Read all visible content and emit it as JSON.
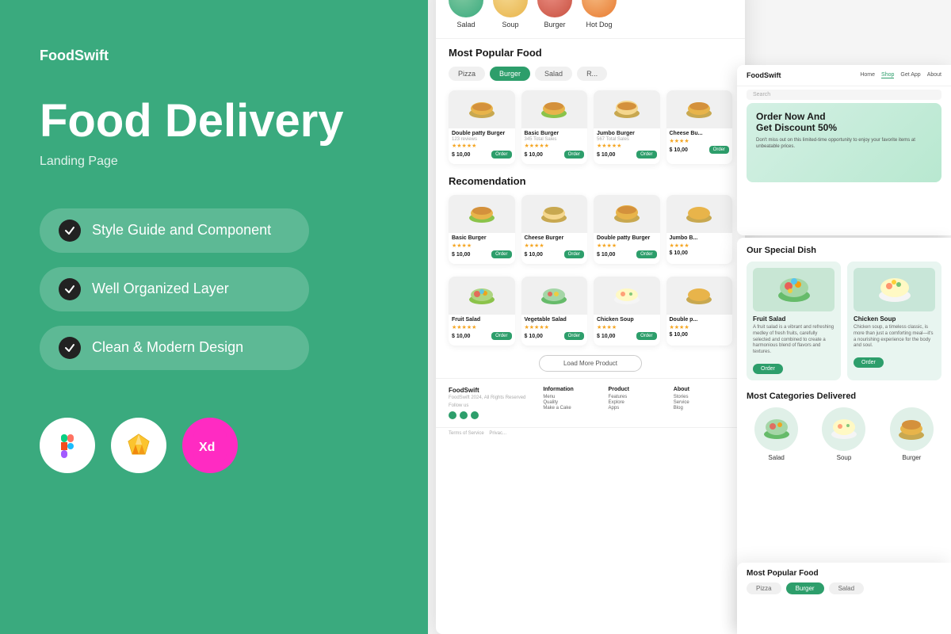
{
  "left": {
    "brand": "FoodSwift",
    "title": "Food Delivery",
    "subtitle": "Landing Page",
    "features": [
      {
        "id": "style-guide",
        "label": "Style Guide and Component"
      },
      {
        "id": "well-organized",
        "label": "Well Organized Layer"
      },
      {
        "id": "clean-modern",
        "label": "Clean & Modern Design"
      }
    ],
    "tools": [
      {
        "id": "figma",
        "label": "Figma"
      },
      {
        "id": "sketch",
        "label": "Sketch"
      },
      {
        "id": "xd",
        "label": "Adobe XD"
      }
    ]
  },
  "mockup": {
    "brand": "FoodSwift",
    "categories": [
      {
        "label": "Salad"
      },
      {
        "label": "Soup"
      },
      {
        "label": "Burger"
      }
    ],
    "most_popular_title": "Most Popular Food",
    "filter_tabs": [
      "Pizza",
      "Burger",
      "Salad",
      "R..."
    ],
    "active_tab": "Burger",
    "food_items_row1": [
      {
        "name": "Double patty Burger",
        "sub": "123 reviews",
        "price": "$ 10,00",
        "stars": "★★★★★"
      },
      {
        "name": "Basic Burger",
        "sub": "345 Total Sales",
        "price": "$ 10,00",
        "stars": "★★★★★"
      },
      {
        "name": "Jumbo Burger",
        "sub": "567 Total Sales",
        "price": "$ 10,00",
        "stars": "★★★★★"
      },
      {
        "name": "Cheese Bu...",
        "sub": "",
        "price": "$ 10,00",
        "stars": "★★★★"
      }
    ],
    "recommendation_title": "Recomendation",
    "food_items_row2": [
      {
        "name": "Basic Burger",
        "price": "$ 10,00",
        "stars": "★★★★"
      },
      {
        "name": "Cheese Burger",
        "price": "$ 10,00",
        "stars": "★★★★"
      },
      {
        "name": "Double patty Burger",
        "price": "$ 10,00",
        "stars": "★★★★"
      },
      {
        "name": "Jumbo B...",
        "price": "$ 10,00",
        "stars": "★★★★"
      }
    ],
    "food_items_row3": [
      {
        "name": "Fruit Salad",
        "price": "$ 10,00",
        "stars": "★★★★★"
      },
      {
        "name": "Vegetable Salad",
        "price": "$ 10,00",
        "stars": "★★★★★"
      },
      {
        "name": "Chicken Soup",
        "price": "$ 10,00",
        "stars": "★★★★"
      },
      {
        "name": "Double p...",
        "price": "$ 10,00",
        "stars": "★★★★"
      }
    ],
    "load_more_label": "Load More Product",
    "footer": {
      "brand": "FoodSwift",
      "copy": "FoodSwift 2024, All Rights Reserved",
      "follow_us": "Follow us",
      "info_col": {
        "title": "Information",
        "items": [
          "Menu",
          "Quality",
          "Make a Cake"
        ]
      },
      "product_col": {
        "title": "Product",
        "items": [
          "Features",
          "Explore",
          "Apps"
        ]
      },
      "about_col": {
        "title": "About",
        "items": [
          "Stories",
          "Service",
          "Blog"
        ]
      },
      "legal": "Terms of Service   Privac..."
    },
    "secondary": {
      "brand": "FoodSwift",
      "nav": [
        "Home",
        "Shop",
        "Get App",
        "About"
      ],
      "active_nav": "Shop",
      "search_placeholder": "Search",
      "hero_title": "Order Now And Get Discount 50%",
      "hero_sub": "Don't miss out on this limited-time opportunity to enjoy your favorite items at unbeatable prices."
    },
    "special_dish_title": "Our Special Dish",
    "special_dishes": [
      {
        "name": "Fruit Salad",
        "desc": "A fruit salad is a vibrant and refreshing medley of fresh fruits, carefully selected and combined to create a harmonious blend of flavors and textures.",
        "btn": "Order"
      },
      {
        "name": "Chicken Soup",
        "desc": "Chicken soup, a timeless classic, is more than just a comforting meal—it's a nourishing experience for the body and soul.",
        "btn": "Order"
      }
    ],
    "categories_title": "Most Categories Delivered",
    "bottom_title": "Most Popular Food",
    "bottom_tabs": [
      "Pizza",
      "Burger",
      "Salad"
    ]
  },
  "colors": {
    "primary": "#3aaa7e",
    "dark": "#1a1a1a",
    "white": "#ffffff"
  }
}
